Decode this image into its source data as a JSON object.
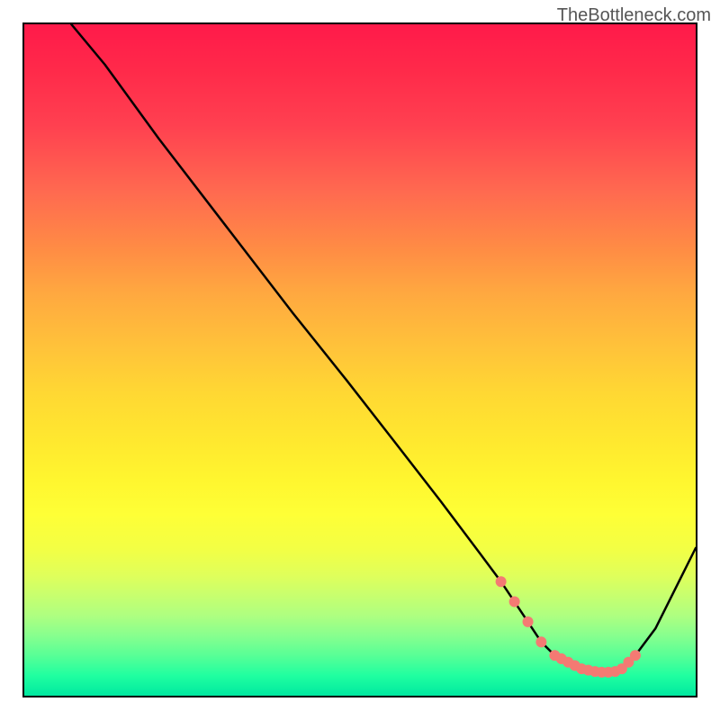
{
  "watermark": "TheBottleneck.com",
  "chart_data": {
    "type": "line",
    "title": "",
    "xlabel": "",
    "ylabel": "",
    "xlim": [
      0,
      100
    ],
    "ylim": [
      0,
      100
    ],
    "series": [
      {
        "name": "curve",
        "x": [
          7,
          12,
          20,
          30,
          40,
          48,
          55,
          62,
          68,
          71,
          73,
          75,
          77,
          79,
          81,
          83,
          85,
          87,
          89,
          91,
          94,
          100
        ],
        "values": [
          100,
          94,
          83,
          70,
          57,
          47,
          38,
          29,
          21,
          17,
          14,
          11,
          8,
          6,
          5,
          4,
          3.5,
          3.5,
          4,
          6,
          10,
          22
        ]
      }
    ],
    "markers": {
      "name": "dots",
      "x": [
        71,
        73,
        75,
        77,
        79,
        80,
        81,
        82,
        83,
        84,
        85,
        86,
        87,
        88,
        89,
        90,
        91
      ],
      "values": [
        17,
        14,
        11,
        8,
        6,
        5.5,
        5,
        4.5,
        4,
        3.8,
        3.6,
        3.5,
        3.5,
        3.6,
        4,
        5,
        6
      ]
    },
    "gradient_stops": [
      {
        "pos": 0,
        "color": "#ff1a4a"
      },
      {
        "pos": 50,
        "color": "#ffc83a"
      },
      {
        "pos": 75,
        "color": "#feff36"
      },
      {
        "pos": 100,
        "color": "#00e8a0"
      }
    ]
  }
}
